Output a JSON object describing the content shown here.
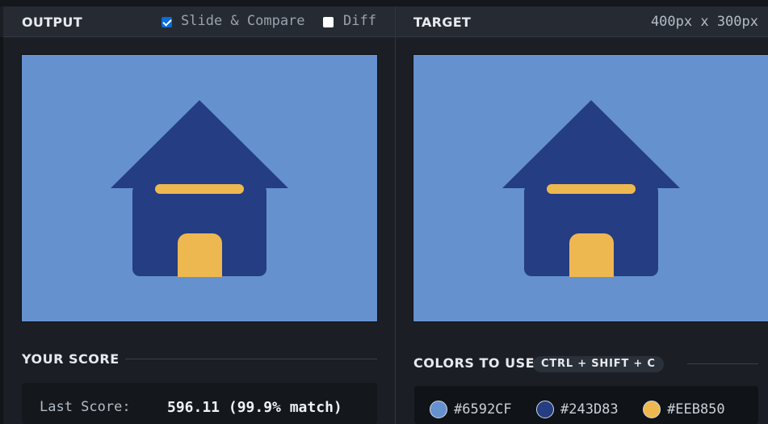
{
  "output_panel": {
    "title": "OUTPUT",
    "slide_compare": {
      "label": "Slide & Compare",
      "checked": true
    },
    "diff": {
      "label": "Diff",
      "checked": false
    }
  },
  "target_panel": {
    "title": "TARGET",
    "dimensions": "400px x 300px"
  },
  "score": {
    "title": "YOUR SCORE",
    "last_score_label": "Last Score:",
    "last_score_value": "596.11 (99.9% match)"
  },
  "colors": {
    "title": "COLORS TO USE",
    "shortcut": "CTRL + SHIFT + C",
    "swatches": [
      {
        "hex": "#6592CF"
      },
      {
        "hex": "#243D83"
      },
      {
        "hex": "#EEB850"
      }
    ]
  },
  "illustration": {
    "background": "#6592CF",
    "house_color": "#243D83",
    "accent_color": "#EEB850"
  }
}
